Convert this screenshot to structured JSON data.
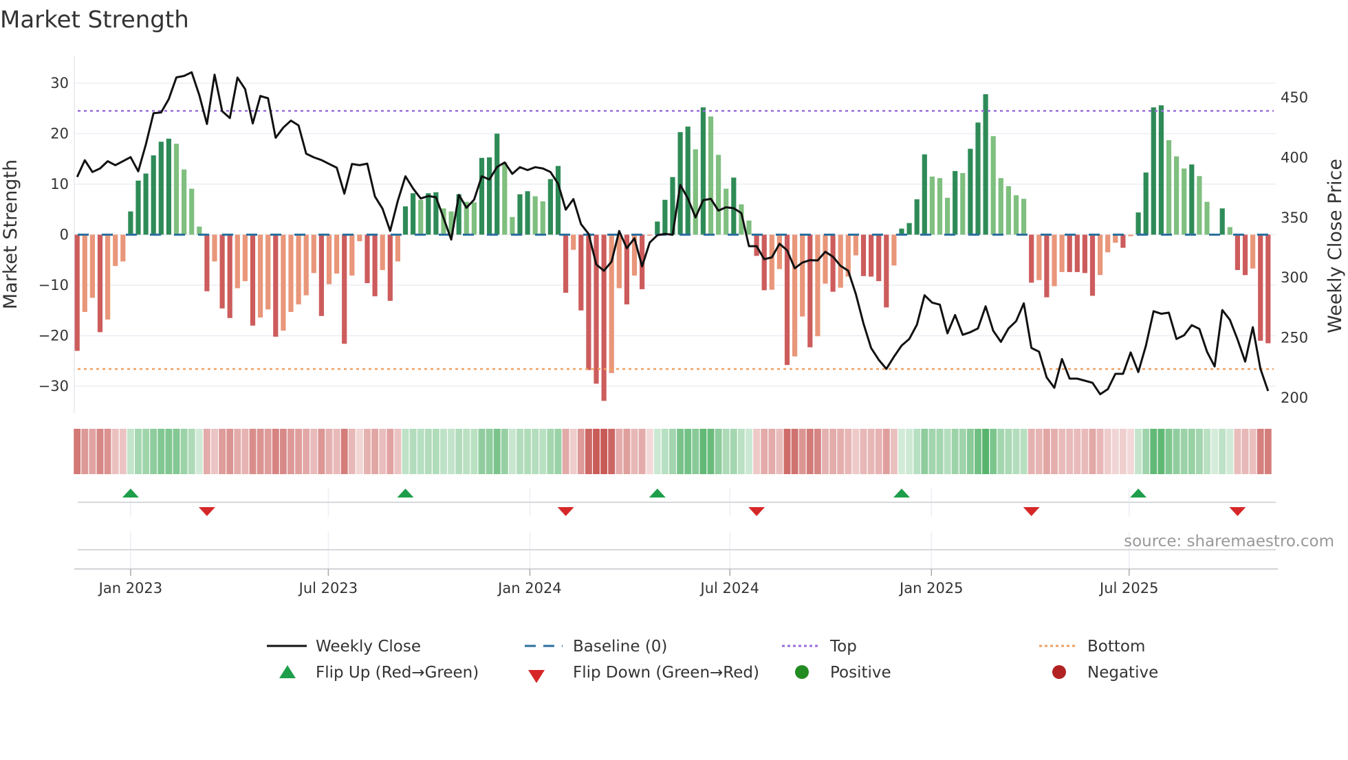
{
  "chart_data": {
    "type": "bar",
    "title": "Market Strength",
    "ylabel": "Market Strength",
    "y2label": "Weekly Close Price",
    "ylim": [
      -35.3,
      35.3
    ],
    "y2lim": [
      187.4,
      484.3
    ],
    "yticks": [
      30,
      20,
      10,
      0,
      -10,
      -20,
      -30
    ],
    "ytick_labels": [
      "30",
      "20",
      "10",
      "0",
      "−10",
      "−20",
      "−30"
    ],
    "y2ticks": [
      450,
      400,
      350,
      300,
      250,
      200
    ],
    "y2tick_labels": [
      "450",
      "400",
      "350",
      "300",
      "250",
      "200"
    ],
    "x_unit": "week index",
    "xticks": [
      7.0,
      32.9,
      59.3,
      85.5,
      111.9,
      137.8
    ],
    "xtick_labels": [
      "Jan 2023",
      "Jul 2023",
      "Jan 2024",
      "Jul 2024",
      "Jan 2025",
      "Jul 2025"
    ],
    "top_level": 24.5,
    "bottom_level": -26.6,
    "baseline": 0,
    "grid": true,
    "legend_placement": "bottom-center",
    "strength": [
      -23.0,
      -15.3,
      -12.5,
      -19.3,
      -16.8,
      -6.2,
      -5.3,
      4.6,
      10.7,
      12.1,
      15.7,
      18.4,
      19.0,
      18.0,
      12.9,
      9.1,
      1.6,
      -11.2,
      -5.3,
      -14.6,
      -16.5,
      -10.6,
      -9.2,
      -18.0,
      -16.4,
      -14.8,
      -20.2,
      -19.0,
      -15.3,
      -13.8,
      -12.0,
      -7.6,
      -16.1,
      -9.8,
      -7.7,
      -21.6,
      -8.1,
      -1.3,
      -9.6,
      -12.2,
      -7.0,
      -13.1,
      -5.3,
      5.6,
      8.2,
      6.9,
      8.2,
      8.4,
      5.2,
      4.6,
      8.0,
      6.5,
      6.4,
      15.2,
      15.3,
      20.0,
      14.3,
      3.5,
      8.0,
      8.6,
      7.6,
      6.6,
      11.0,
      13.6,
      -11.5,
      -3.0,
      -15.0,
      -26.8,
      -29.5,
      -32.9,
      -27.4,
      -10.6,
      -13.8,
      -8.1,
      -10.8,
      -0.2,
      2.6,
      6.9,
      11.4,
      20.3,
      21.4,
      16.9,
      25.2,
      23.4,
      15.8,
      9.1,
      11.3,
      6.0,
      2.8,
      -4.2,
      -11.0,
      -10.9,
      -6.8,
      -25.8,
      -24.1,
      -16.2,
      -22.3,
      -20.1,
      -9.7,
      -11.3,
      -10.5,
      -8.3,
      -4.1,
      -8.2,
      -8.3,
      -9.2,
      -14.4,
      -6.1,
      1.2,
      2.3,
      7.0,
      15.9,
      11.5,
      11.2,
      7.3,
      12.6,
      12.2,
      17.0,
      22.2,
      27.8,
      19.5,
      11.2,
      9.6,
      7.8,
      7.1,
      -9.5,
      -9.0,
      -12.4,
      -10.2,
      -7.4,
      -7.4,
      -7.4,
      -7.6,
      -12.1,
      -8.0,
      -3.5,
      -1.6,
      -2.6,
      -0.3,
      4.4,
      12.3,
      25.2,
      25.6,
      18.7,
      15.5,
      13.1,
      13.9,
      11.6,
      6.5,
      0.2,
      5.2,
      1.5,
      -7.0,
      -8.0,
      -6.7,
      -21.0,
      -21.5
    ],
    "weekly_close": [
      383.9,
      397.8,
      388,
      391,
      397,
      393.7,
      397,
      400.4,
      388.6,
      411,
      437,
      437.6,
      448.8,
      466.8,
      468,
      471,
      452,
      428,
      469,
      438.6,
      433,
      466.6,
      457,
      428.4,
      451.3,
      449.4,
      416.5,
      425,
      430.8,
      426.8,
      403.3,
      400.2,
      398,
      394.7,
      391.6,
      370,
      394.7,
      393.7,
      395,
      367.7,
      357.5,
      339,
      364,
      384.5,
      374.3,
      366,
      368,
      367,
      349.7,
      331.8,
      369,
      358.3,
      365,
      384.5,
      381.8,
      392.2,
      396,
      386.5,
      392,
      389.6,
      392,
      391,
      388,
      378.3,
      356.7,
      365.5,
      344.6,
      336.5,
      311,
      305.8,
      313.4,
      338.9,
      324.6,
      332.8,
      309.5,
      329.3,
      335.4,
      336.5,
      335.8,
      377.3,
      366,
      350.2,
      364.5,
      365.7,
      355.9,
      358.7,
      357.9,
      353.8,
      326.3,
      326.3,
      315.4,
      317,
      328.3,
      322.8,
      307.9,
      312.6,
      314.6,
      314.4,
      321.6,
      317.5,
      309.9,
      305.8,
      286.4,
      261.9,
      241.5,
      231.7,
      224.1,
      234.3,
      243.5,
      249,
      260.9,
      285.4,
      279.3,
      277.6,
      253.7,
      269,
      252.5,
      254.7,
      257.8,
      276.2,
      255.8,
      246.6,
      257.8,
      263.9,
      278.7,
      241.5,
      238.4,
      217,
      208.4,
      232.3,
      216,
      216,
      214.3,
      212.5,
      203,
      207.2,
      220,
      220,
      237.8,
      221.5,
      243.5,
      272.1,
      270,
      270.9,
      249,
      252.1,
      260.5,
      257.4,
      238.4,
      226.1,
      273.1,
      265,
      248.6,
      230.2,
      258.8,
      224.1,
      205.7
    ],
    "legend": {
      "weekly_close": "Weekly Close",
      "baseline": "Baseline (0)",
      "top": "Top",
      "bottom": "Bottom",
      "flip_up": "Flip Up (Red→Green)",
      "flip_down": "Flip Down (Green→Red)",
      "positive": "Positive",
      "negative": "Negative"
    },
    "source": "source: sharemaestro.com",
    "colors": {
      "pos_strong": "#2e8b57",
      "pos_weak": "#7fbf7f",
      "neg_strong": "#cd5c5c",
      "neg_weak": "#e9967a",
      "line": "#111111",
      "baseline": "#2b6f9e",
      "top": "#9a6ddb",
      "bottom": "#f0a060",
      "flip_up": "#1e9e4a",
      "flip_down": "#d62728",
      "positive": "#228b22",
      "negative": "#b22222",
      "heat_pos": "#4caf63",
      "heat_neg": "#c85a57",
      "grid": "#eceef4"
    }
  }
}
